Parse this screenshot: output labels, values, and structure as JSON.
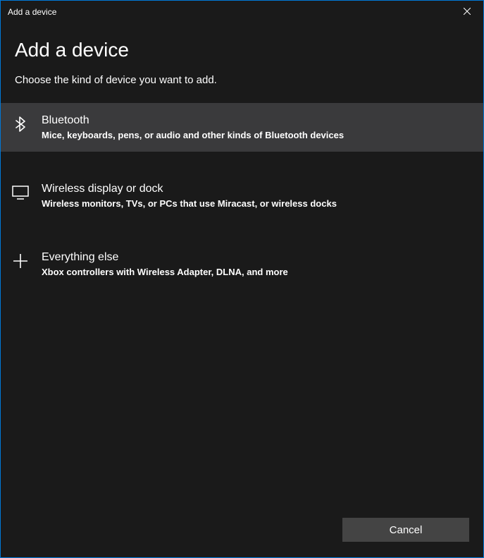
{
  "titlebar": {
    "title": "Add a device"
  },
  "header": {
    "heading": "Add a device",
    "subheading": "Choose the kind of device you want to add."
  },
  "options": [
    {
      "icon": "bluetooth-icon",
      "title": "Bluetooth",
      "desc": "Mice, keyboards, pens, or audio and other kinds of Bluetooth devices"
    },
    {
      "icon": "display-icon",
      "title": "Wireless display or dock",
      "desc": "Wireless monitors, TVs, or PCs that use Miracast, or wireless docks"
    },
    {
      "icon": "plus-icon",
      "title": "Everything else",
      "desc": "Xbox controllers with Wireless Adapter, DLNA, and more"
    }
  ],
  "footer": {
    "cancel_label": "Cancel"
  }
}
